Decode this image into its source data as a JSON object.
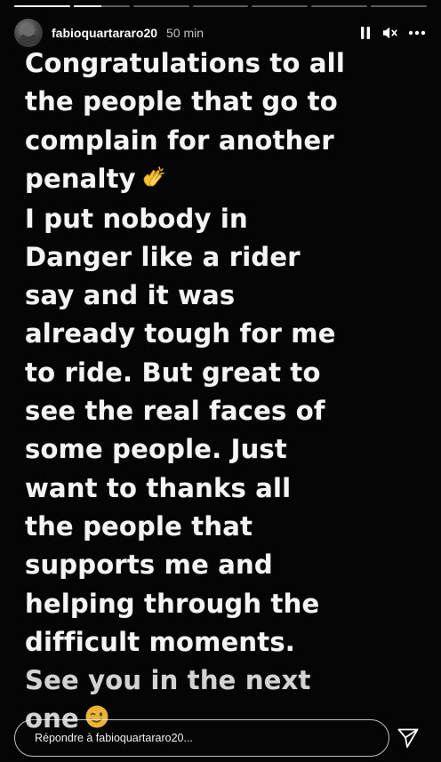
{
  "story": {
    "progress_segments": [
      1.0,
      0.5,
      0,
      0,
      0,
      0,
      0
    ],
    "username": "fabioquartararo20",
    "time_ago": "50 min",
    "controls": {
      "pause_icon": "pause-icon",
      "mute_icon": "speaker-muted-icon",
      "more_icon": "more-options-icon"
    },
    "lines": [
      "Congratulations to all",
      "the people that go to",
      "complain for another",
      "penalty",
      "I put nobody in",
      "Danger like a rider",
      "say and it was",
      "already tough for me",
      "to ride. But great to",
      "see the real faces of",
      "some people. Just",
      "want to thanks all",
      "the people that",
      "supports me and",
      "helping through the",
      "difficult moments.",
      "See you in the next",
      "one"
    ],
    "emojis": {
      "clap": "clapping-hands-emoji",
      "wink": "winking-face-emoji"
    }
  },
  "reply": {
    "placeholder": "Répondre à fabioquartararo20..."
  },
  "colors": {
    "background": "#000000",
    "text": "#f4f4f4",
    "emoji_yellow": "#f7c232"
  }
}
